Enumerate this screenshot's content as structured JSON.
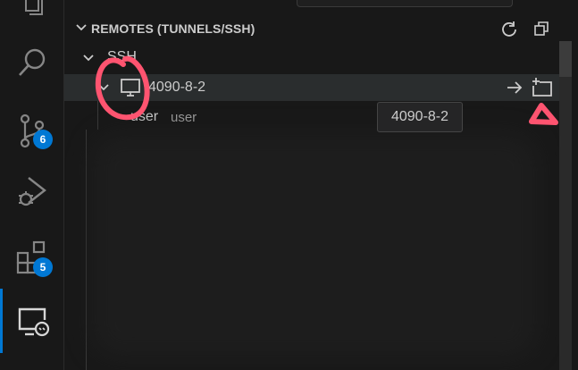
{
  "activity_bar": {
    "items": [
      {
        "name": "explorer",
        "icon": "files-icon"
      },
      {
        "name": "search",
        "icon": "search-icon"
      },
      {
        "name": "source-control",
        "icon": "source-control-icon",
        "badge": "6"
      },
      {
        "name": "run-and-debug",
        "icon": "debug-icon"
      },
      {
        "name": "extensions",
        "icon": "extensions-icon",
        "badge": "5"
      },
      {
        "name": "remote-explorer",
        "icon": "remote-explorer-icon",
        "active": true
      }
    ]
  },
  "remote_explorer": {
    "title": "REMOTES (TUNNELS/SSH)",
    "ssh_section": {
      "label": "SSH"
    },
    "host": {
      "name": "4090-8-2"
    },
    "user": {
      "label": "user",
      "description": "user"
    },
    "tooltip": "4090-8-2"
  },
  "colors": {
    "accent": "#0078d4",
    "badge": "#0078d4",
    "annotation": "#ff5470"
  }
}
